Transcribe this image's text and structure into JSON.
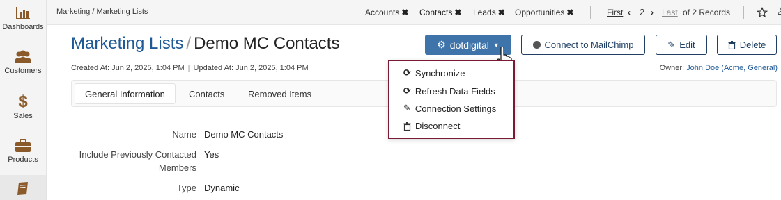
{
  "sidebar": {
    "items": [
      {
        "label": "Dashboards",
        "icon": "bar-chart-icon"
      },
      {
        "label": "Customers",
        "icon": "users-icon"
      },
      {
        "label": "Sales",
        "icon": "dollar-icon"
      },
      {
        "label": "Products",
        "icon": "briefcase-icon"
      },
      {
        "label": "",
        "icon": "book-icon"
      }
    ],
    "accent_color": "#8a5a2b"
  },
  "topbar": {
    "breadcrumb": "Marketing / Marketing Lists",
    "recent_tabs": [
      "Accounts",
      "Contacts",
      "Leads",
      "Opportunities"
    ],
    "pager": {
      "first": "First",
      "page": "2",
      "last": "Last",
      "summary": "of 2 Records"
    }
  },
  "header": {
    "title_parent": "Marketing Lists",
    "title_separator": "/",
    "title_record": "Demo MC Contacts",
    "created": "Created At: Jun 2, 2025, 1:04 PM",
    "updated": "Updated At: Jun 2, 2025, 1:04 PM",
    "owner_label": "Owner:",
    "owner_value": "John Doe (Acme, General)"
  },
  "actions": {
    "dotdigital": "dotdigital",
    "mailchimp": "Connect to MailChimp",
    "edit": "Edit",
    "delete": "Delete"
  },
  "dropdown": {
    "items": [
      {
        "label": "Synchronize",
        "icon": "sync-icon"
      },
      {
        "label": "Refresh Data Fields",
        "icon": "refresh-icon"
      },
      {
        "label": "Connection Settings",
        "icon": "edit-icon"
      },
      {
        "label": "Disconnect",
        "icon": "trash-icon"
      }
    ]
  },
  "tabs": [
    "General Information",
    "Contacts",
    "Removed Items"
  ],
  "fields": [
    {
      "label": "Name",
      "value": "Demo MC Contacts"
    },
    {
      "label_line1": "Include Previously Contacted",
      "label_line2": "Members",
      "value": "Yes"
    },
    {
      "label": "Type",
      "value": "Dynamic"
    }
  ],
  "colors": {
    "link": "#1f5a96",
    "primary_button": "#3f74aa",
    "dropdown_border": "#7a1a35"
  }
}
